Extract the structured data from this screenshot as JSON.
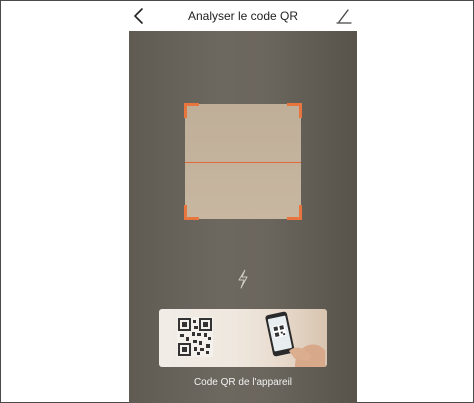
{
  "header": {
    "title": "Analyser le code QR",
    "back_icon": "chevron-left-icon",
    "edit_icon": "pencil-icon"
  },
  "scanner": {
    "flash_icon": "lightning-icon",
    "accent_color": "#e8743e"
  },
  "device_code": {
    "label": "Code QR de l'appareil",
    "image": "qr-and-phone-illustration"
  }
}
